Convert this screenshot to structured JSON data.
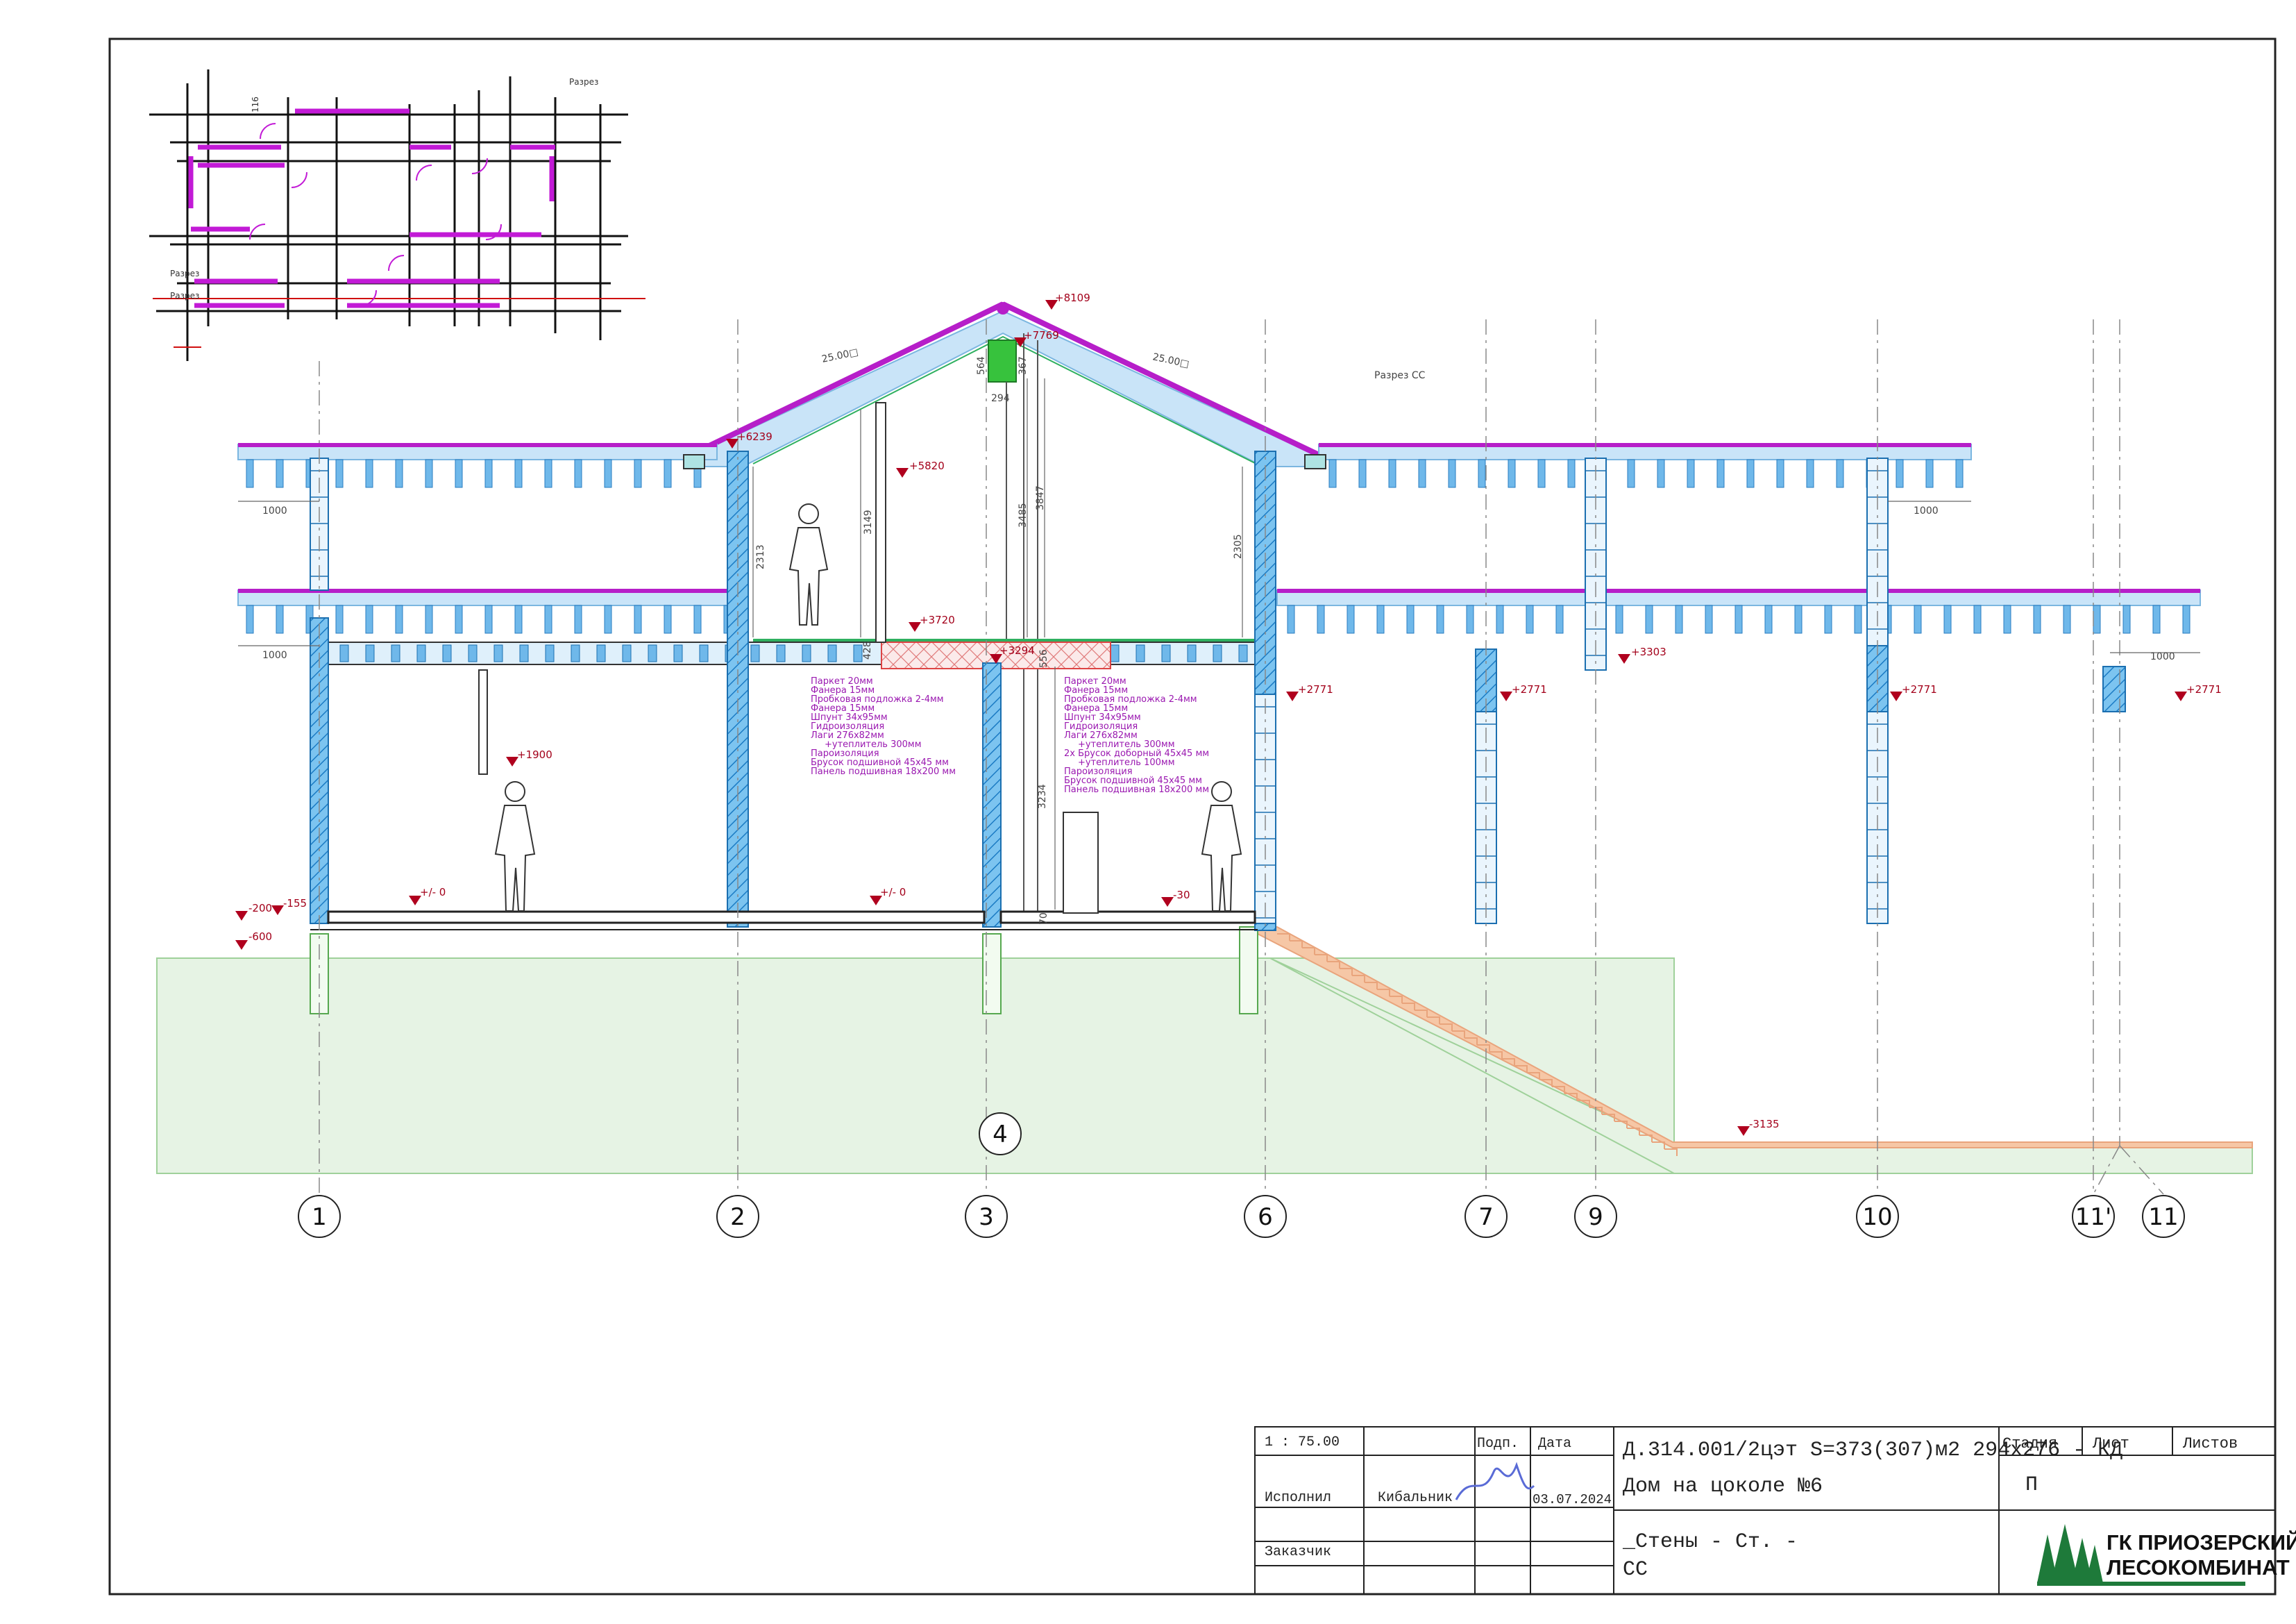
{
  "plan_inset": {
    "section_marks": [
      "Разрез",
      "Разрез",
      "Разрез"
    ],
    "dims": [
      "116"
    ]
  },
  "section_title": "Разрез   СС",
  "roof_slopes": [
    "25.00□",
    "25.00□"
  ],
  "levels": {
    "ridge": "+8109",
    "ridge_inner": "+7769",
    "eave_left": "+6239",
    "attic_mark": "+5820",
    "attic_floor": "+3720",
    "attic_mid": "+3294",
    "wing_beam": "+3303",
    "beam_6": "+2771",
    "beam_7": "+2771",
    "beam_10": "+2771",
    "beam_11": "+2771",
    "window_1": "+1900",
    "floor_left": "+/- 0",
    "floor_mid": "+/- 0",
    "floor_right": "-30",
    "ground_1": "-200",
    "ground_2": "-155",
    "ground_3": "-600",
    "slope_bottom": "-3135"
  },
  "dims": {
    "eave_left": "1000",
    "floor_left": "1000",
    "eave_right": "1000",
    "floor_right": "1000",
    "h_2313": "2313",
    "h_3149": "3149",
    "h_3485": "3485",
    "h_3847": "3847",
    "h_2305": "2305",
    "h_3234": "3234",
    "w_294": "294",
    "h_564": "564",
    "h_367": "367",
    "h_428": "428",
    "h_556": "556",
    "h_70": "70"
  },
  "notes_left": [
    "Паркет 20мм",
    "Фанера 15мм",
    "Пробковая подложка 2-4мм",
    "Фанера 15мм",
    "Шпунт 34х95мм",
    "Гидроизоляция",
    "Лаги 276х82мм",
    "+утеплитель  300мм",
    "Пароизоляция",
    "Брусок подшивной 45х45 мм",
    "Панель подшивная 18х200 мм"
  ],
  "notes_right": [
    "Паркет 20мм",
    "Фанера 15мм",
    "Пробковая подложка 2-4мм",
    "Фанера 15мм",
    "Шпунт 34х95мм",
    "Гидроизоляция",
    "Лаги 276х82мм",
    "+утеплитель  300мм",
    "2х Брусок доборный 45х45 мм",
    "+утеплитель  100мм",
    "Пароизоляция",
    "Брусок подшивной 45х45 мм",
    "Панель подшивная 18х200 мм"
  ],
  "axes": [
    "1",
    "2",
    "3",
    "4",
    "6",
    "7",
    "9",
    "10",
    "11'",
    "11"
  ],
  "title_block": {
    "scale": "1 : 75.00",
    "col_sign": "Подп.",
    "col_date": "Дата",
    "row_author": "Исполнил",
    "author_name": "Кибальник",
    "date": "03.07.2024",
    "row_customer": "Заказчик",
    "doc_code": "Д.314.001/2цэт S=373(307)м2 294х276 - КД",
    "doc_title": "Дом на цоколе №6",
    "sheet_title_1": "_Стены - Ст. -",
    "sheet_title_2": "СС",
    "stage_label": "Стадия",
    "stage_value": "П",
    "sheet_label": "Лист",
    "sheets_label": "Листов",
    "company_line1": "ГК ПРИОЗЕРСКИЙ",
    "company_line2": "ЛЕСОКОМБИНАТ"
  },
  "colors": {
    "wall": "#3aa6e8",
    "roof": "#b61ec9",
    "roof_fill": "#c9e4f8",
    "ground": "#e6f3e4",
    "ground_edge": "#9fd19a",
    "stairs": "#f6c7a6",
    "level_mark": "#b0001e",
    "company_green": "#1e7a3a"
  }
}
